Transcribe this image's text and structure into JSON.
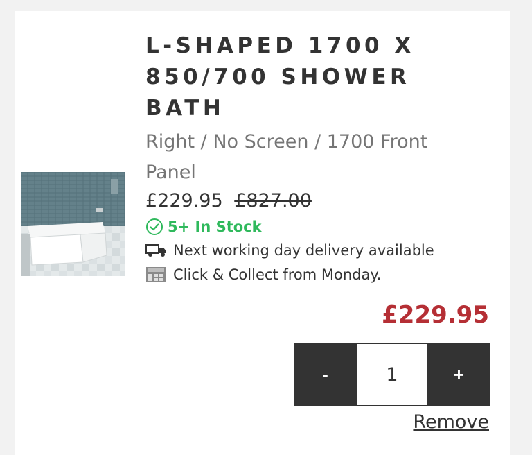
{
  "product": {
    "title": "L-SHAPED 1700 X 850/700 SHOWER BATH",
    "variant": "Right / No Screen / 1700 Front Panel",
    "price": "£229.95",
    "was_price": "£827.00",
    "stock": "5+ In Stock",
    "delivery": "Next working day delivery available",
    "collect": "Click & Collect from Monday.",
    "image_icon": "bath-product-image"
  },
  "cart": {
    "line_total": "£229.95",
    "decrement_label": "-",
    "quantity": "1",
    "increment_label": "+",
    "remove_label": "Remove"
  },
  "colors": {
    "stock_green": "#2fb95c",
    "total_red": "#b52f35",
    "button_dark": "#333333"
  }
}
